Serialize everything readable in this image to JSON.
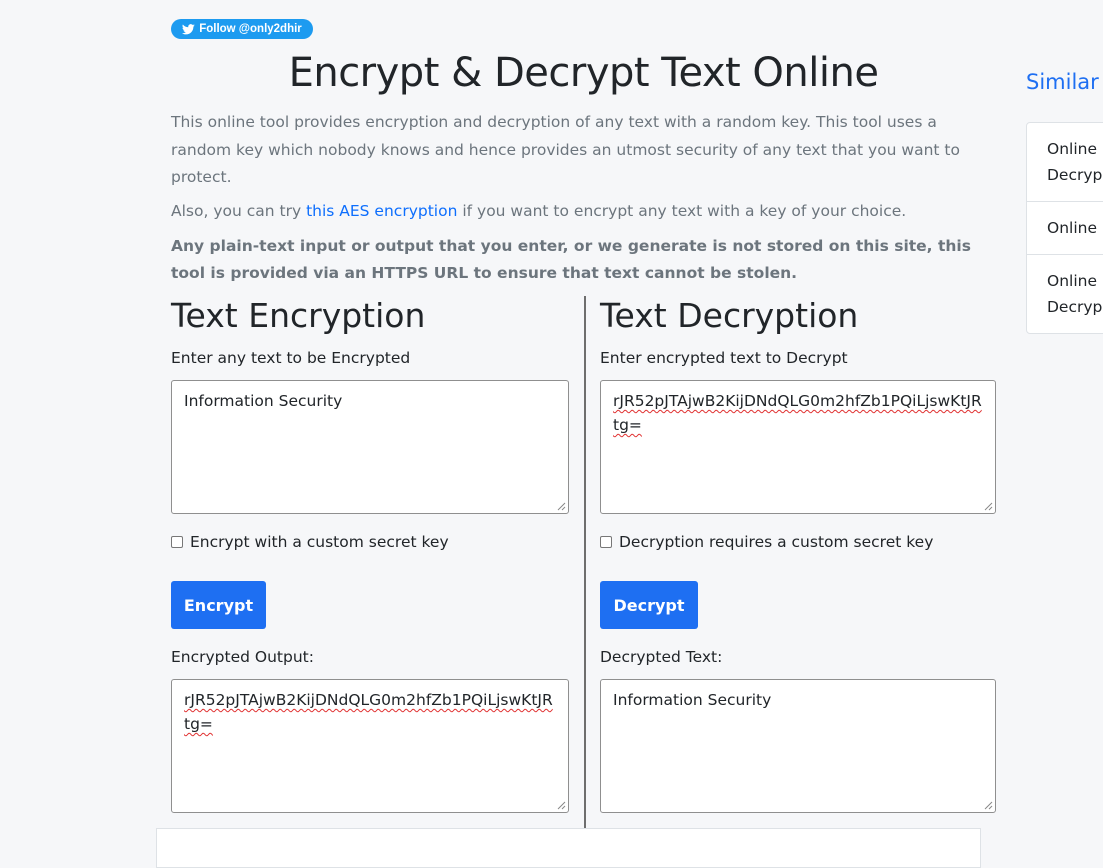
{
  "follow_button": {
    "label": "Follow @only2dhir",
    "icon": "twitter-bird-icon"
  },
  "page_title": "Encrypt & Decrypt Text Online",
  "intro_text": "This online tool provides encryption and decryption of any text with a random key. This tool uses a random key which nobody knows and hence provides an utmost security of any text that you want to protect.",
  "aes_line": {
    "prefix": "Also, you can try ",
    "link_text": "this AES encryption",
    "suffix": " if you want to encrypt any text with a key of your choice."
  },
  "notice_text": "Any plain-text input or output that you enter, or we generate is not stored on this site, this tool is provided via an HTTPS URL to ensure that text cannot be stolen.",
  "encryption": {
    "title": "Text Encryption",
    "input_label": "Enter any text to be Encrypted",
    "input_value": "Information Security",
    "custom_key_label": "Encrypt with a custom secret key",
    "custom_key_checked": false,
    "button_label": "Encrypt",
    "output_label": "Encrypted Output:",
    "output_value": "rJR52pJTAjwB2KijDNdQLG0m2hfZb1PQiLjswKtJRtg="
  },
  "decryption": {
    "title": "Text Decryption",
    "input_label": "Enter encrypted text to Decrypt",
    "input_value": "rJR52pJTAjwB2KijDNdQLG0m2hfZb1PQiLjswKtJRtg=",
    "custom_key_label": "Decryption requires a custom secret key",
    "custom_key_checked": false,
    "button_label": "Decrypt",
    "output_label": "Decrypted Text:",
    "output_value": "Information Security"
  },
  "similar": {
    "title": "Similar",
    "items": [
      {
        "label": "Online\nDecryp"
      },
      {
        "label": "Online"
      },
      {
        "label": "Online\nDecryp"
      }
    ]
  },
  "colors": {
    "accent": "#1e6ff2",
    "link": "#0d6efd",
    "muted_text": "#6c757d",
    "background": "#f6f7f9",
    "twitter": "#1d9bf0"
  }
}
